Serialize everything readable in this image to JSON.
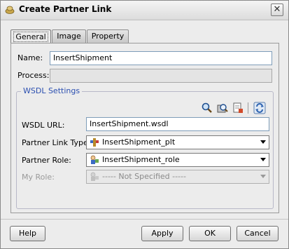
{
  "window": {
    "title": "Create Partner Link",
    "close_label": "✕"
  },
  "tabs": [
    {
      "label": "General",
      "active": true
    },
    {
      "label": "Image",
      "active": false
    },
    {
      "label": "Property",
      "active": false
    }
  ],
  "form": {
    "name_label": "Name:",
    "name_value": "InsertShipment",
    "process_label": "Process:",
    "process_value": "",
    "wsdl_group_title": "WSDL Settings",
    "wsdl_url_label": "WSDL URL:",
    "wsdl_url_value": "InsertShipment.wsdl",
    "partner_link_type_label": "Partner Link Type:",
    "partner_link_type_value": "InsertShipment_plt",
    "partner_role_label": "Partner Role:",
    "partner_role_value": "InsertShipment_role",
    "my_role_label": "My Role:",
    "my_role_value": "----- Not Specified -----"
  },
  "toolbar_icons": [
    "search-icon",
    "service-explorer-icon",
    "define-adapter-icon",
    "refresh-icon"
  ],
  "buttons": {
    "help": "Help",
    "apply": "Apply",
    "ok": "OK",
    "cancel": "Cancel"
  },
  "colors": {
    "group_title": "#2b4fb0",
    "field_border": "#7f9db9"
  }
}
